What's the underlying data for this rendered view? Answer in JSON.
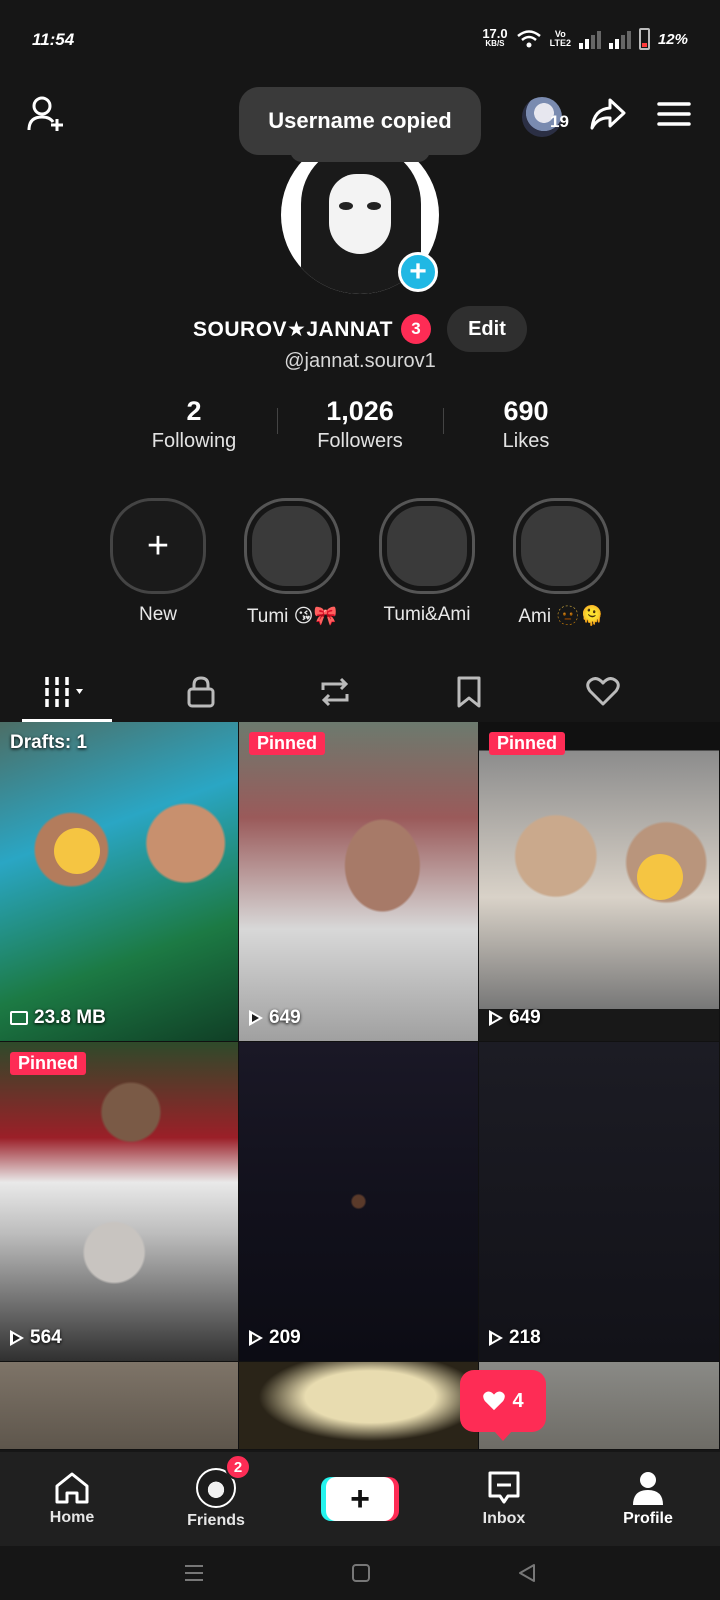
{
  "status_bar": {
    "time": "11:54",
    "net_speed_value": "17.0",
    "net_speed_unit": "KB/S",
    "volte_top": "Vo",
    "volte_bottom": "LTE2",
    "battery_percent": "12%"
  },
  "top_bar": {
    "toast_text": "Username copied",
    "profile_views_count": "19",
    "icons": [
      "add-friend-icon",
      "share-icon",
      "menu-icon"
    ]
  },
  "profile": {
    "display_name": "SOUROV★JANNAT",
    "notification_badge": "3",
    "edit_label": "Edit",
    "username": "@jannat.sourov1",
    "stats": [
      {
        "value": "2",
        "label": "Following"
      },
      {
        "value": "1,026",
        "label": "Followers"
      },
      {
        "value": "690",
        "label": "Likes"
      }
    ]
  },
  "highlights": [
    {
      "label": "New"
    },
    {
      "label": "Tumi 😘🎀"
    },
    {
      "label": "Tumi&Ami"
    },
    {
      "label": "Ami 🫥🫠"
    }
  ],
  "tabs": [
    "videos-grid-icon",
    "lock-icon",
    "repost-icon",
    "bookmark-icon",
    "heart-icon"
  ],
  "videos": [
    {
      "tag": "Drafts: 1",
      "meta": "23.8 MB",
      "kind": "draft"
    },
    {
      "tag": "Pinned",
      "meta": "649"
    },
    {
      "tag": "Pinned",
      "meta": "649"
    },
    {
      "tag": "Pinned",
      "meta": "564"
    },
    {
      "tag": "",
      "meta": "209"
    },
    {
      "tag": "",
      "meta": "218"
    }
  ],
  "like_notification": {
    "count": "4"
  },
  "bottom_nav": {
    "home": "Home",
    "friends": "Friends",
    "friends_badge": "2",
    "inbox": "Inbox",
    "profile": "Profile"
  }
}
